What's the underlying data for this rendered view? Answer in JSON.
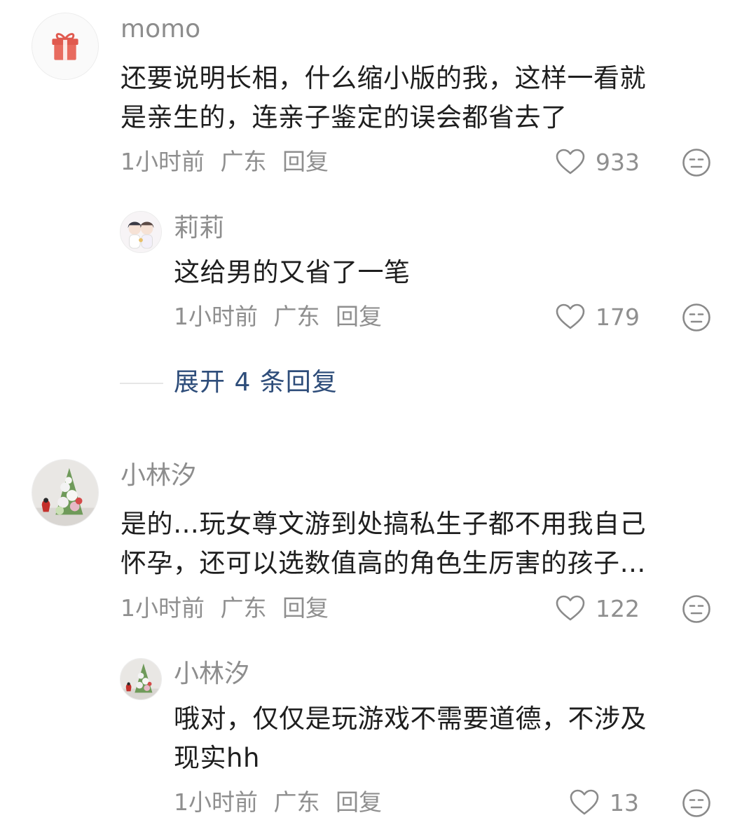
{
  "comments": [
    {
      "username": "momo",
      "avatar_icon": "gift-icon",
      "content_line1": "还要说明长相，什么缩小版的我，这样一看就",
      "content_line2": "是亲生的，连亲子鉴定的误会都省去了",
      "time": "1小时前",
      "location": "广东",
      "reply_label": "回复",
      "likes": "933",
      "replies": [
        {
          "username": "莉莉",
          "avatar_icon": "anime-couple-avatar",
          "content_line1": "这给男的又省了一笔",
          "time": "1小时前",
          "location": "广东",
          "reply_label": "回复",
          "likes": "179"
        }
      ],
      "expand_label": "展开 4 条回复"
    },
    {
      "username": "小林汐",
      "avatar_icon": "flower-tree-avatar",
      "content_line1": "是的…玩女尊文游到处搞私生子都不用我自己",
      "content_line2": "怀孕，还可以选数值高的角色生厉害的孩子…",
      "time": "1小时前",
      "location": "广东",
      "reply_label": "回复",
      "likes": "122",
      "replies": [
        {
          "username": "小林汐",
          "avatar_icon": "flower-tree-avatar",
          "content_line1": "哦对，仅仅是玩游戏不需要道德，不涉及",
          "content_line2": "现实hh",
          "time": "1小时前",
          "location": "广东",
          "reply_label": "回复",
          "likes": "13"
        }
      ]
    }
  ],
  "colors": {
    "text": "#1e1e1e",
    "meta": "#8f8f8f",
    "expand_link": "#2e4d7a",
    "gift_red": "#e05a4f"
  }
}
